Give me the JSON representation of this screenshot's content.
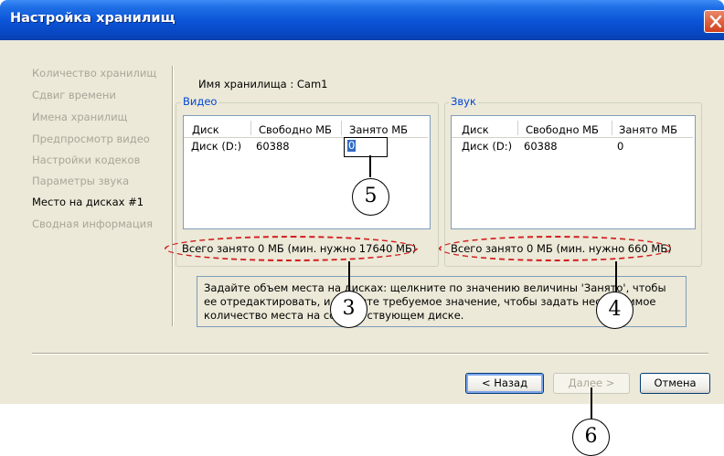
{
  "window": {
    "title": "Настройка хранилищ"
  },
  "sidebar": {
    "items": [
      {
        "label": "Количество хранилищ",
        "active": false
      },
      {
        "label": "Сдвиг времени",
        "active": false
      },
      {
        "label": "Имена хранилищ",
        "active": false
      },
      {
        "label": "Предпросмотр видео",
        "active": false
      },
      {
        "label": "Настройки кодеков",
        "active": false
      },
      {
        "label": "Параметры звука",
        "active": false
      },
      {
        "label": "Место на дисках #1",
        "active": true
      },
      {
        "label": "Сводная информация",
        "active": false
      }
    ]
  },
  "storage_name_label": "Имя хранилища : Cam1",
  "video": {
    "group_label": "Видео",
    "columns": [
      "Диск",
      "Свободно МБ",
      "Занято МБ"
    ],
    "rows": [
      {
        "disk": "Диск (D:)",
        "free": "60388",
        "used": "0"
      }
    ],
    "total": "Всего занято 0 МБ (мин. нужно 17640 МБ)"
  },
  "audio": {
    "group_label": "Звук",
    "columns": [
      "Диск",
      "Свободно МБ",
      "Занято МБ"
    ],
    "rows": [
      {
        "disk": "Диск (D:)",
        "free": "60388",
        "used": "0"
      }
    ],
    "total": "Всего занято 0 МБ (мин. нужно 660 МБ)"
  },
  "hint": {
    "text": "Задайте объем места на дисках: щелкните по значению величины 'Занято', чтобы ее отредактировать, и введите требуемое значение, чтобы задать необходимое количество места на соответствующем диске."
  },
  "buttons": {
    "back": "< Назад",
    "next": "Далее >",
    "cancel": "Отмена"
  },
  "callouts": [
    "3",
    "4",
    "5",
    "6"
  ],
  "colors": {
    "titlebar": "#0a52d6",
    "highlight_oval": "#d21f1f",
    "group_label": "#0046d5",
    "selection": "#316ac5"
  },
  "icons": {
    "close": "close-icon"
  }
}
